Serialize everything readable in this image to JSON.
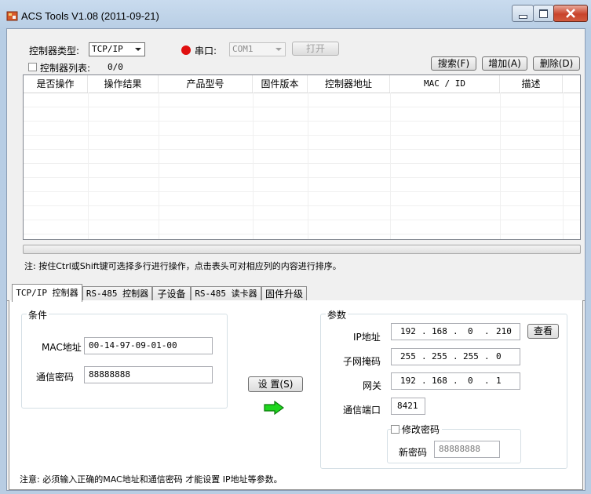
{
  "window": {
    "title": "ACS Tools V1.08 (2011-09-21)",
    "icons": {
      "app": "tools-icon",
      "minimize": "minimize-icon",
      "maximize": "maximize-icon",
      "close": "close-icon"
    }
  },
  "top": {
    "controller_type_label": "控制器类型:",
    "controller_type_value": "TCP/IP",
    "serial_label": "串口:",
    "serial_value": "COM1",
    "open_button": "打开",
    "list_checkbox_label": "控制器列表:",
    "list_count": "0/0",
    "search_button": "搜索(F)",
    "add_button": "增加(A)",
    "delete_button": "删除(D)",
    "serial_status_color": "#e01010"
  },
  "list": {
    "columns": [
      "是否操作",
      "操作结果",
      "产品型号",
      "固件版本",
      "控制器地址",
      "MAC / ID",
      "描述"
    ],
    "rows": []
  },
  "note_top": "注: 按住Ctrl或Shift键可选择多行进行操作，点击表头可对相应列的内容进行排序。",
  "tabs": [
    "TCP/IP 控制器",
    "RS-485 控制器",
    "子设备",
    "RS-485 读卡器",
    "固件升级"
  ],
  "tcp": {
    "condition_group": "条件",
    "mac_label": "MAC地址",
    "mac_value": "00-14-97-09-01-00",
    "password_label": "通信密码",
    "password_value": "88888888",
    "set_button": "设 置(S)",
    "params_group": "参数",
    "ip_label": "IP地址",
    "ip": [
      "192",
      "168",
      "0",
      "210"
    ],
    "view_button": "查看",
    "mask_label": "子网掩码",
    "mask": [
      "255",
      "255",
      "255",
      "0"
    ],
    "gateway_label": "网关",
    "gateway": [
      "192",
      "168",
      "0",
      "1"
    ],
    "port_label": "通信端口",
    "port_value": "8421",
    "change_password_label": "修改密码",
    "new_password_label": "新密码",
    "new_password_value": "88888888",
    "bottom_note": "注意: 必须输入正确的MAC地址和通信密码 才能设置 IP地址等参数。",
    "arrow_color": "#1fd61f"
  }
}
